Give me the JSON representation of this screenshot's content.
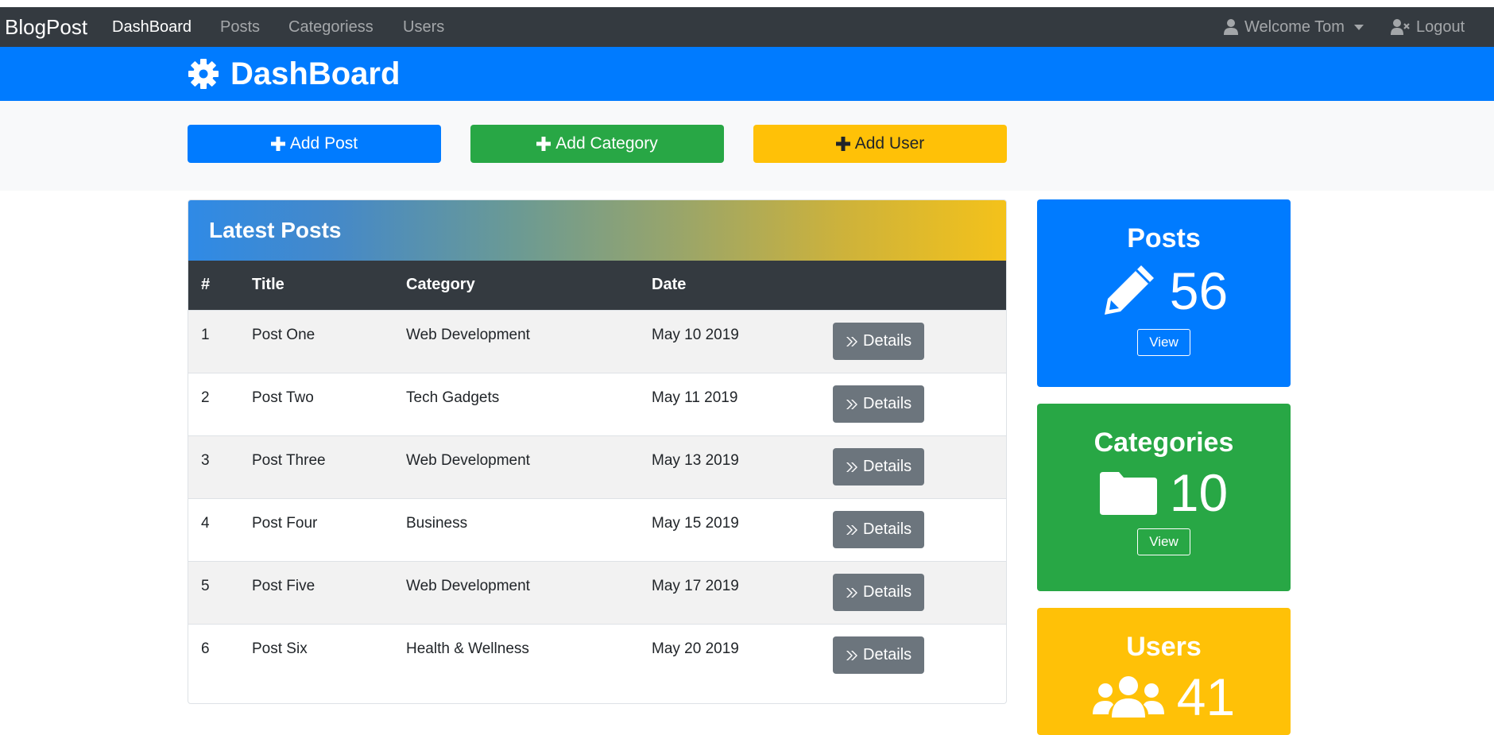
{
  "navbar": {
    "brand": "BlogPost",
    "links": [
      {
        "label": "DashBoard"
      },
      {
        "label": "Posts"
      },
      {
        "label": "Categoriess"
      },
      {
        "label": "Users"
      }
    ],
    "welcome": "Welcome Tom",
    "logout": "Logout"
  },
  "header": {
    "title": "DashBoard"
  },
  "actions": {
    "add_post": "Add Post",
    "add_category": "Add Category",
    "add_user": "Add User"
  },
  "posts_card": {
    "title": "Latest Posts",
    "columns": [
      "#",
      "Title",
      "Category",
      "Date"
    ],
    "details_label": "Details",
    "rows": [
      {
        "num": "1",
        "title": "Post One",
        "category": "Web Development",
        "date": "May 10 2019"
      },
      {
        "num": "2",
        "title": "Post Two",
        "category": "Tech Gadgets",
        "date": "May 11 2019"
      },
      {
        "num": "3",
        "title": "Post Three",
        "category": "Web Development",
        "date": "May 13 2019"
      },
      {
        "num": "4",
        "title": "Post Four",
        "category": "Business",
        "date": "May 15 2019"
      },
      {
        "num": "5",
        "title": "Post Five",
        "category": "Web Development",
        "date": "May 17 2019"
      },
      {
        "num": "6",
        "title": "Post Six",
        "category": "Health & Wellness",
        "date": "May 20 2019"
      }
    ]
  },
  "stats": {
    "posts": {
      "title": "Posts",
      "count": "56",
      "view": "View"
    },
    "categories": {
      "title": "Categories",
      "count": "10",
      "view": "View"
    },
    "users": {
      "title": "Users",
      "count": "41"
    }
  },
  "colors": {
    "primary": "#007bff",
    "success": "#28a745",
    "warning": "#ffc107",
    "dark": "#343a40",
    "secondary": "#6c757d"
  },
  "icons": [
    "user-icon",
    "user-times-icon",
    "cog-icon",
    "plus-icon",
    "angle-double-right-icon",
    "pencil-icon",
    "folder-icon",
    "users-icon"
  ]
}
